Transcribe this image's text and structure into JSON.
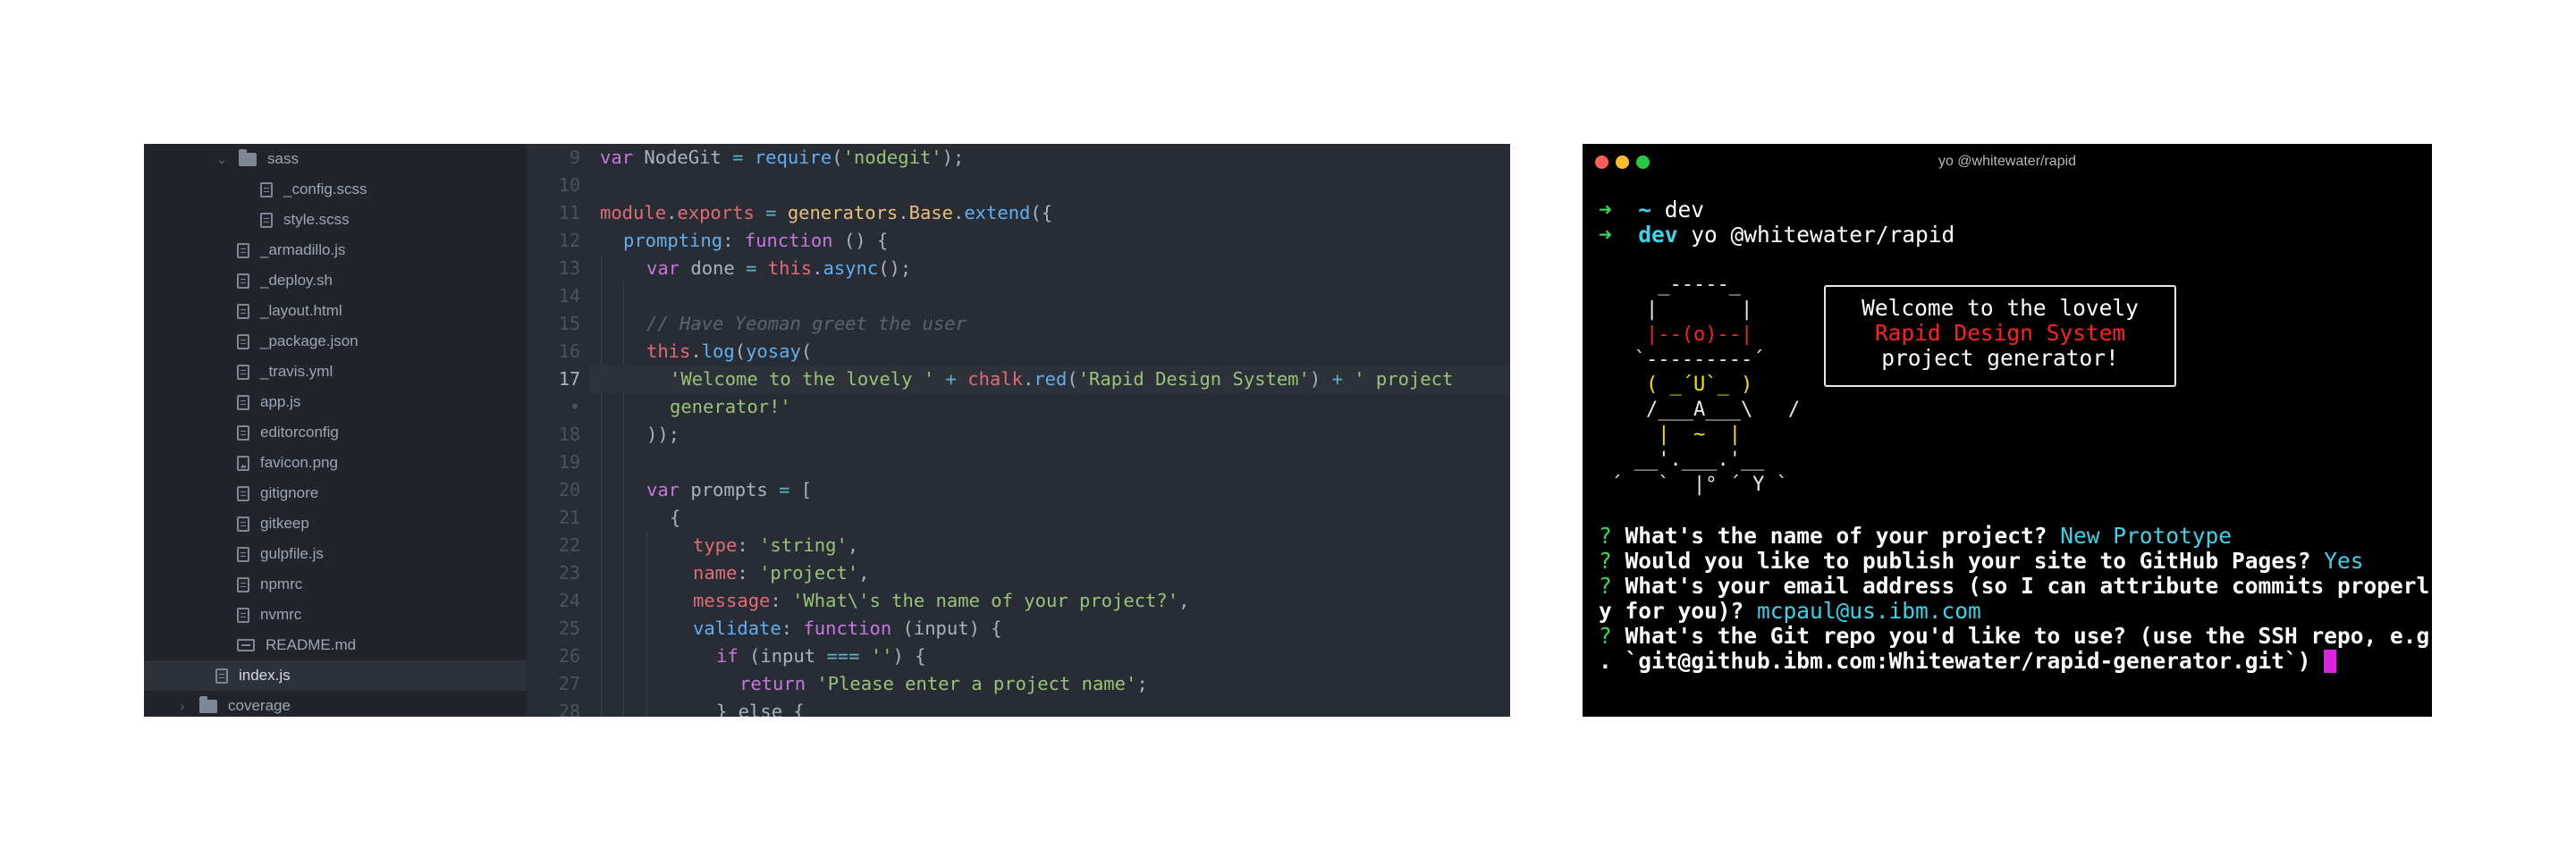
{
  "editor": {
    "tree": {
      "items": [
        {
          "label": "sass",
          "kind": "folder-open"
        },
        {
          "label": "_config.scss",
          "kind": "file"
        },
        {
          "label": "style.scss",
          "kind": "file"
        },
        {
          "label": "_armadillo.js",
          "kind": "file"
        },
        {
          "label": "_deploy.sh",
          "kind": "file"
        },
        {
          "label": "_layout.html",
          "kind": "file"
        },
        {
          "label": "_package.json",
          "kind": "file"
        },
        {
          "label": "_travis.yml",
          "kind": "file"
        },
        {
          "label": "app.js",
          "kind": "file"
        },
        {
          "label": "editorconfig",
          "kind": "file"
        },
        {
          "label": "favicon.png",
          "kind": "image"
        },
        {
          "label": "gitignore",
          "kind": "file"
        },
        {
          "label": "gitkeep",
          "kind": "file"
        },
        {
          "label": "gulpfile.js",
          "kind": "file"
        },
        {
          "label": "npmrc",
          "kind": "file"
        },
        {
          "label": "nvmrc",
          "kind": "file"
        },
        {
          "label": "README.md",
          "kind": "markdown"
        },
        {
          "label": "index.js",
          "kind": "file",
          "selected": true
        },
        {
          "label": "coverage",
          "kind": "folder-closed"
        }
      ]
    },
    "line_numbers": [
      "9",
      "10",
      "11",
      "12",
      "13",
      "14",
      "15",
      "16",
      "17",
      "•",
      "18",
      "19",
      "20",
      "21",
      "22",
      "23",
      "24",
      "25",
      "26",
      "27",
      "28"
    ],
    "active_line": "17",
    "code": {
      "l9": {
        "a": "var",
        "b": " NodeGit ",
        "c": "=",
        "d": " ",
        "e": "require",
        "f": "(",
        "g": "'nodegit'",
        "h": ");"
      },
      "l11": {
        "a": "module",
        "b": ".",
        "c": "exports",
        "d": " = ",
        "e": "generators",
        "f": ".",
        "g": "Base",
        "h": ".",
        "i": "extend",
        "j": "({"
      },
      "l12": {
        "a": "prompting",
        "b": ": ",
        "c": "function",
        "d": " () {"
      },
      "l13": {
        "a": "var",
        "b": " done ",
        "c": "=",
        "d": " ",
        "e": "this",
        "f": ".",
        "g": "async",
        "h": "();"
      },
      "l15": {
        "a": "// Have Yeoman greet the user"
      },
      "l16": {
        "a": "this",
        "b": ".",
        "c": "log",
        "d": "(",
        "e": "yosay",
        "f": "("
      },
      "l17": {
        "a": "'Welcome to the lovely '",
        "b": " + ",
        "c": "chalk",
        "d": ".",
        "e": "red",
        "f": "(",
        "g": "'Rapid Design System'",
        "h": ") ",
        "i": "+",
        "j": " ",
        "k": "' project"
      },
      "l17b": {
        "a": "generator!'"
      },
      "l18": {
        "a": "));"
      },
      "l20": {
        "a": "var",
        "b": " prompts ",
        "c": "=",
        "d": " ["
      },
      "l21": {
        "a": "{"
      },
      "l22": {
        "a": "type",
        "b": ": ",
        "c": "'string'",
        "d": ","
      },
      "l23": {
        "a": "name",
        "b": ": ",
        "c": "'project'",
        "d": ","
      },
      "l24": {
        "a": "message",
        "b": ": ",
        "c": "'What\\'s the name of your project?'",
        "d": ","
      },
      "l25": {
        "a": "validate",
        "b": ": ",
        "c": "function",
        "d": " (input) {"
      },
      "l26": {
        "a": "if",
        "b": " (input ",
        "c": "===",
        "d": " ",
        "e": "''",
        "f": ") {"
      },
      "l27": {
        "a": "return",
        "b": " ",
        "c": "'Please enter a project name'",
        "d": ";"
      },
      "l28": {
        "a": "} else {"
      }
    }
  },
  "terminal": {
    "title": "yo @whitewater/rapid",
    "traffic_colors": [
      "#fe5f57",
      "#febc2e",
      "#28c840"
    ],
    "history": [
      {
        "arrow": "➜",
        "path": "~",
        "cmd": " dev"
      },
      {
        "arrow": "➜",
        "path": "dev",
        "cmd": " yo @whitewater/rapid"
      }
    ],
    "art": [
      "     _-----_",
      "    |       |",
      "    |--(o)--|",
      "   `---------´",
      "    ( _´U`_ )",
      "    /___A___\\   /",
      "     |  ~  |",
      "   __'.___.'__",
      " ´   `  |° ´ Y `"
    ],
    "welcome": {
      "line1": "Welcome to the lovely",
      "line2": "Rapid Design System",
      "line3": "project generator!"
    },
    "prompts": [
      {
        "q": "?",
        "text": " What's the name of your project? ",
        "answer": "New Prototype"
      },
      {
        "q": "?",
        "text": " Would you like to publish your site to GitHub Pages? ",
        "answer": "Yes"
      },
      {
        "q": "?",
        "text": " What's your email address (so I can attribute commits properl",
        "answer": ""
      },
      {
        "q": "",
        "text": "y for you)? ",
        "answer": "mcpaul@us.ibm.com"
      },
      {
        "q": "?",
        "text": " What's the Git repo you'd like to use? (use the SSH repo, e.g",
        "answer": ""
      },
      {
        "q": "",
        "text": ". `git@github.ibm.com:Whitewater/rapid-generator.git`) ",
        "answer": ""
      }
    ],
    "colors": {
      "prompt_arrow": "#2fdc5a",
      "answer": "#39d5ec",
      "cursor": "#e020e0"
    }
  }
}
